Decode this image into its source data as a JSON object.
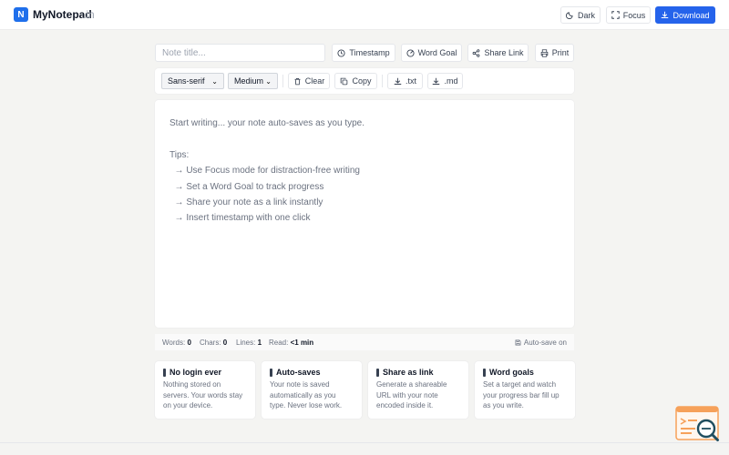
{
  "header": {
    "logo_letter": "N",
    "app_name": "MyNotepad",
    "tld": ".in",
    "dark_label": "Dark",
    "focus_label": "Focus",
    "download_label": "Download"
  },
  "title_row": {
    "title_placeholder": "Note title...",
    "title_value": "",
    "timestamp_label": "Timestamp",
    "word_goal_label": "Word Goal",
    "share_link_label": "Share Link",
    "print_label": "Print"
  },
  "toolbar": {
    "font_family": "Sans-serif",
    "font_size": "Medium",
    "clear_label": "Clear",
    "copy_label": "Copy",
    "txt_label": ".txt",
    "md_label": ".md"
  },
  "editor": {
    "placeholder": "Start writing... your note auto-saves as you type.\n\nTips:\n  → Use Focus mode for distraction-free writing\n  → Set a Word Goal to track progress\n  → Share your note as a link instantly\n  → Insert timestamp with one click"
  },
  "status": {
    "words_label": "Words:",
    "words_value": "0",
    "chars_label": "Chars:",
    "chars_value": "0",
    "lines_label": "Lines:",
    "lines_value": "1",
    "read_label": "Read:",
    "read_value": "<1 min",
    "autosave_label": "Auto-save on"
  },
  "features": [
    {
      "title": "No login ever",
      "desc": "Nothing stored on servers. Your words stay on your device."
    },
    {
      "title": "Auto-saves",
      "desc": "Your note is saved automatically as you type. Never lose work."
    },
    {
      "title": "Share as link",
      "desc": "Generate a shareable URL with your note encoded inside it."
    },
    {
      "title": "Word goals",
      "desc": "Set a target and watch your progress bar fill up as you write."
    }
  ],
  "colors": {
    "accent": "#2563eb",
    "background": "#f4f4f2",
    "badge_orange": "#f6a15a"
  }
}
